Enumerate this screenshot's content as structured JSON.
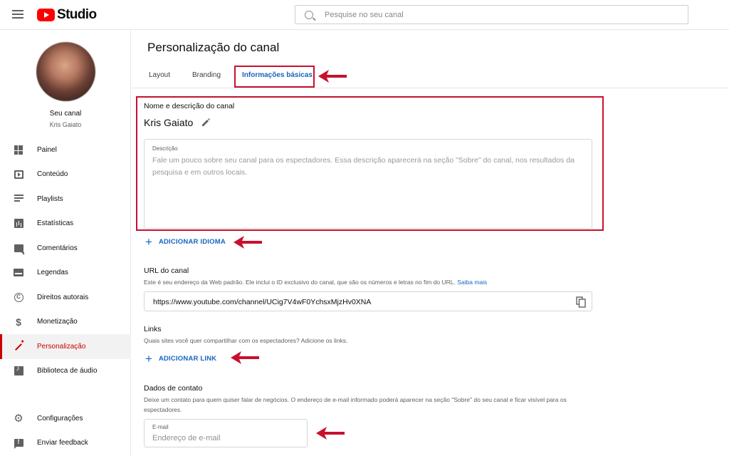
{
  "header": {
    "logo_text": "Studio",
    "search_placeholder": "Pesquise no seu canal"
  },
  "sidebar": {
    "channel_label": "Seu canal",
    "channel_owner": "Kris Gaiato",
    "items": [
      {
        "label": "Painel",
        "icon": "dashboard-icon"
      },
      {
        "label": "Conteúdo",
        "icon": "content-icon"
      },
      {
        "label": "Playlists",
        "icon": "playlist-icon"
      },
      {
        "label": "Estatísticas",
        "icon": "analytics-icon"
      },
      {
        "label": "Comentários",
        "icon": "comments-icon"
      },
      {
        "label": "Legendas",
        "icon": "subtitles-icon"
      },
      {
        "label": "Direitos autorais",
        "icon": "copyright-icon"
      },
      {
        "label": "Monetização",
        "icon": "dollar-icon"
      },
      {
        "label": "Personalização",
        "icon": "magic-wand-icon",
        "active": true
      },
      {
        "label": "Biblioteca de áudio",
        "icon": "audio-library-icon"
      }
    ],
    "bottom_items": [
      {
        "label": "Configurações",
        "icon": "gear-icon"
      },
      {
        "label": "Enviar feedback",
        "icon": "feedback-icon"
      }
    ]
  },
  "main": {
    "page_title": "Personalização do canal",
    "tabs": [
      {
        "label": "Layout"
      },
      {
        "label": "Branding"
      },
      {
        "label": "Informações básicas",
        "active": true
      }
    ],
    "name_section": {
      "title": "Nome e descrição do canal",
      "channel_name": "Kris Gaiato",
      "description_label": "Descrição",
      "description_placeholder": "Fale um pouco sobre seu canal para os espectadores. Essa descrição aparecerá na seção \"Sobre\" do canal, nos resultados da pesquisa e em outros locais."
    },
    "add_language_label": "ADICIONAR IDIOMA",
    "url_section": {
      "title": "URL do canal",
      "description": "Este é seu endereço da Web padrão. Ele inclui o ID exclusivo do canal, que são os números e letras no fim do URL.",
      "learn_more": "Saiba mais",
      "url": "https://www.youtube.com/channel/UCig7V4wF0YchsxMjzHv0XNA"
    },
    "links_section": {
      "title": "Links",
      "description": "Quais sites você quer compartilhar com os espectadores? Adicione os links.",
      "add_link_label": "ADICIONAR LINK"
    },
    "contact_section": {
      "title": "Dados de contato",
      "description": "Deixe um contato para quem quiser falar de negócios. O endereço de e-mail informado poderá aparecer na seção \"Sobre\" do seu canal e ficar visível para os espectadores.",
      "email_label": "E-mail",
      "email_placeholder": "Endereço de e-mail"
    }
  },
  "colors": {
    "accent": "#1565c0",
    "active_nav": "#cc0000",
    "annotation": "#c8102e"
  }
}
